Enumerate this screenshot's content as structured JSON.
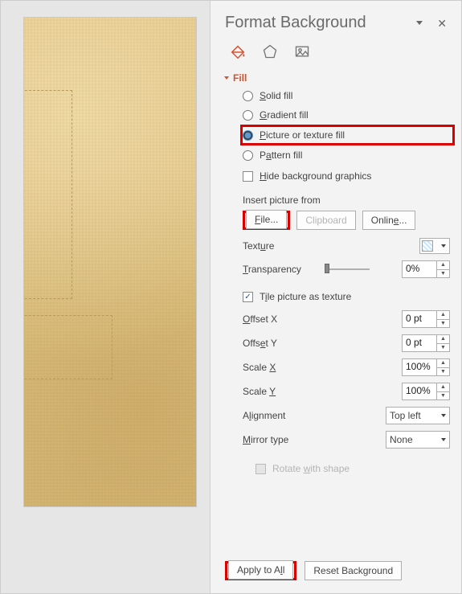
{
  "pane": {
    "title": "Format Background"
  },
  "icons": {
    "fill": "fill-bucket",
    "effects": "pentagon",
    "picture": "picture"
  },
  "fill": {
    "section": "Fill",
    "options": {
      "solid": "Solid fill",
      "gradient": "Gradient fill",
      "picture_texture": "Picture or texture fill",
      "pattern": "Pattern fill"
    },
    "selected": "picture_texture",
    "hide_bg": "Hide background graphics",
    "insert_from": "Insert picture from",
    "buttons": {
      "file": "File...",
      "clipboard": "Clipboard",
      "online": "Online..."
    },
    "texture_label": "Texture",
    "transparency": {
      "label": "Transparency",
      "value": "0%"
    },
    "tile": "Tile picture as texture",
    "offset_x": {
      "label": "Offset X",
      "value": "0 pt"
    },
    "offset_y": {
      "label": "Offset Y",
      "value": "0 pt"
    },
    "scale_x": {
      "label": "Scale X",
      "value": "100%"
    },
    "scale_y": {
      "label": "Scale Y",
      "value": "100%"
    },
    "alignment": {
      "label": "Alignment",
      "value": "Top left"
    },
    "mirror": {
      "label": "Mirror type",
      "value": "None"
    },
    "rotate": "Rotate with shape"
  },
  "footer": {
    "apply_all": "Apply to All",
    "reset": "Reset Background"
  }
}
